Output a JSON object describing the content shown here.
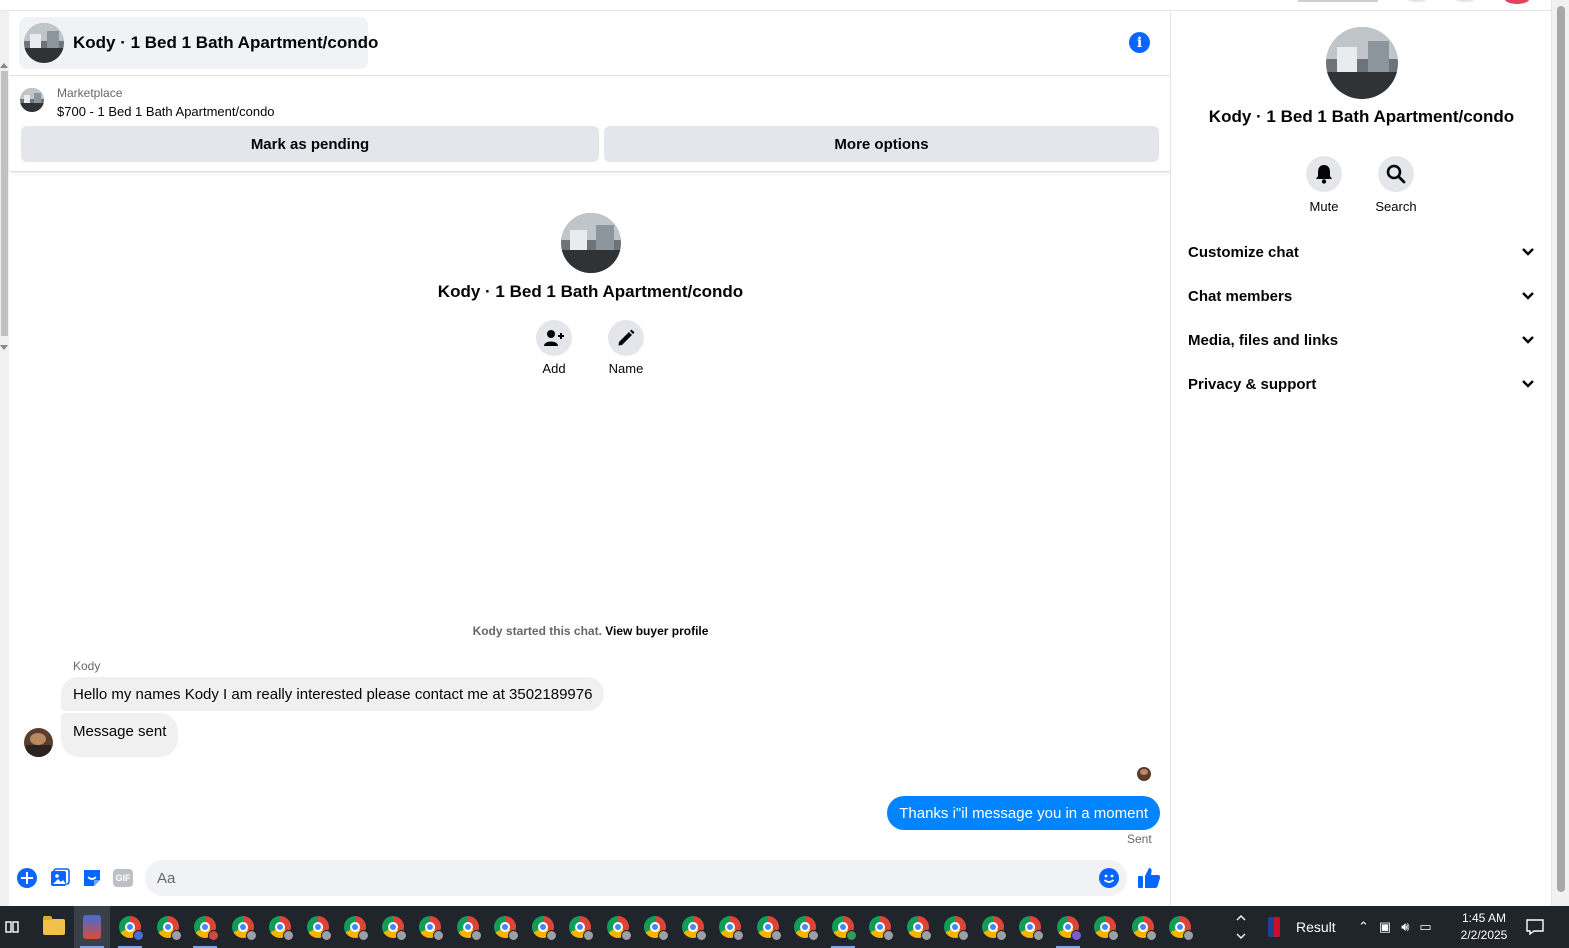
{
  "conversation": {
    "title": "Kody · 1 Bed 1 Bath Apartment/condo"
  },
  "marketplace": {
    "label": "Marketplace",
    "listing": "$700 - 1 Bed 1 Bath Apartment/condo",
    "mark_pending_label": "Mark as pending",
    "more_options_label": "More options"
  },
  "intro": {
    "name": "Kody · 1 Bed 1 Bath Apartment/condo",
    "actions": [
      {
        "label": "Add",
        "icon": "add-person-icon"
      },
      {
        "label": "Name",
        "icon": "pencil-icon"
      }
    ],
    "started_text": "Kody started this chat.",
    "view_buyer_profile": "View buyer profile"
  },
  "messages": {
    "sender_name": "Kody",
    "incoming": [
      "Hello my names Kody I am really interested please contact me at 3502189976",
      "Message sent"
    ],
    "outgoing": "Thanks i\"il message you in a moment",
    "outgoing_status": "Sent"
  },
  "composer": {
    "placeholder": "Aa",
    "gif_label": "GIF"
  },
  "info_panel": {
    "name": "Kody · 1 Bed 1 Bath Apartment/condo",
    "actions": [
      {
        "label": "Mute",
        "icon": "bell-icon"
      },
      {
        "label": "Search",
        "icon": "search-icon"
      }
    ],
    "sections": [
      "Customize chat",
      "Chat members",
      "Media, files and links",
      "Privacy & support"
    ]
  },
  "taskbar": {
    "tray_app_label": "Result",
    "time": "1:45 AM",
    "date": "2/2/2025"
  },
  "colors": {
    "accent": "#0866ff",
    "outgoing_bubble": "#0084ff",
    "incoming_bubble": "#f0f0f0",
    "button_bg": "#e4e6eb",
    "taskbar": "#20242b"
  }
}
